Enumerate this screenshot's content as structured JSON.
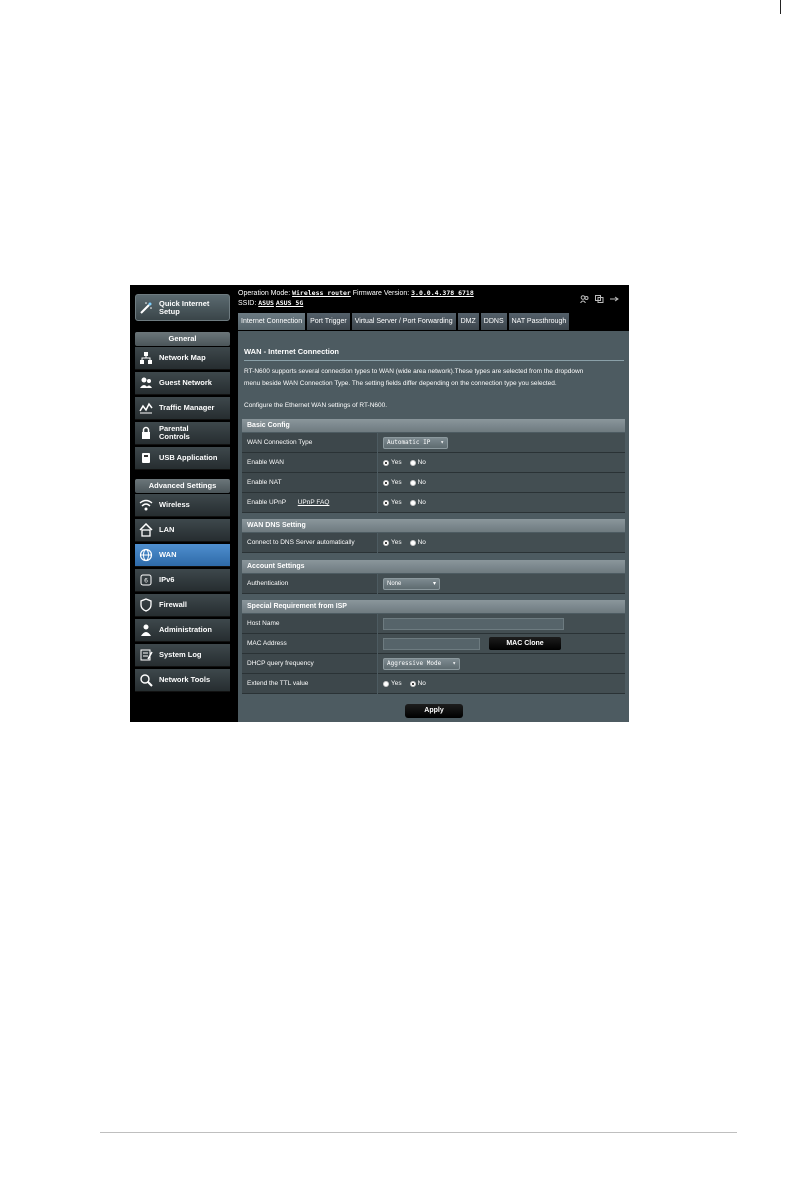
{
  "topbar": {
    "operation_mode_label": "Operation Mode:",
    "operation_mode_value": "Wireless router",
    "firmware_label": "Firmware Version:",
    "firmware_value": "3.0.0.4.378_6718",
    "ssid_label": "SSID:",
    "ssid_1": "ASUS",
    "ssid_2": "ASUS_5G"
  },
  "sidebar": {
    "quick_setup": "Quick Internet Setup",
    "general_header": "General",
    "general_items": [
      {
        "label": "Network Map",
        "icon": "network-map-icon"
      },
      {
        "label": "Guest Network",
        "icon": "guest-network-icon"
      },
      {
        "label": "Traffic Manager",
        "icon": "traffic-manager-icon"
      },
      {
        "label": "Parental Controls",
        "icon": "lock-icon"
      },
      {
        "label": "USB Application",
        "icon": "usb-icon"
      }
    ],
    "advanced_header": "Advanced Settings",
    "advanced_items": [
      {
        "label": "Wireless",
        "icon": "wifi-icon"
      },
      {
        "label": "LAN",
        "icon": "home-icon"
      },
      {
        "label": "WAN",
        "icon": "globe-icon"
      },
      {
        "label": "IPv6",
        "icon": "ipv6-icon"
      },
      {
        "label": "Firewall",
        "icon": "shield-icon"
      },
      {
        "label": "Administration",
        "icon": "admin-icon"
      },
      {
        "label": "System Log",
        "icon": "log-icon"
      },
      {
        "label": "Network Tools",
        "icon": "tools-icon"
      }
    ],
    "active_item": "WAN"
  },
  "tabs": [
    "Internet Connection",
    "Port Trigger",
    "Virtual Server / Port Forwarding",
    "DMZ",
    "DDNS",
    "NAT Passthrough"
  ],
  "content": {
    "title": "WAN - Internet Connection",
    "desc_line1": "RT-N600 supports several connection types to WAN (wide area network).These types are selected from the dropdown",
    "desc_line2": "menu beside WAN Connection Type. The setting fields differ depending on the connection type you selected.",
    "desc_line3": "Configure the Ethernet WAN settings of RT-N600.",
    "basic_config": {
      "header": "Basic Config",
      "wan_type_label": "WAN Connection Type",
      "wan_type_value": "Automatic IP",
      "enable_wan_label": "Enable WAN",
      "enable_nat_label": "Enable NAT",
      "enable_upnp_label": "Enable UPnP",
      "upnp_faq": "UPnP  FAQ"
    },
    "dns": {
      "header": "WAN DNS Setting",
      "auto_label": "Connect to DNS Server automatically"
    },
    "account": {
      "header": "Account Settings",
      "auth_label": "Authentication",
      "auth_value": "None"
    },
    "isp": {
      "header": "Special Requirement from ISP",
      "host_label": "Host Name",
      "host_value": "",
      "mac_label": "MAC Address",
      "mac_value": "",
      "mac_clone": "MAC Clone",
      "dhcp_label": "DHCP query frequency",
      "dhcp_value": "Aggressive Mode",
      "ttl_label": "Extend the TTL value"
    },
    "yes": "Yes",
    "no": "No",
    "apply": "Apply"
  }
}
